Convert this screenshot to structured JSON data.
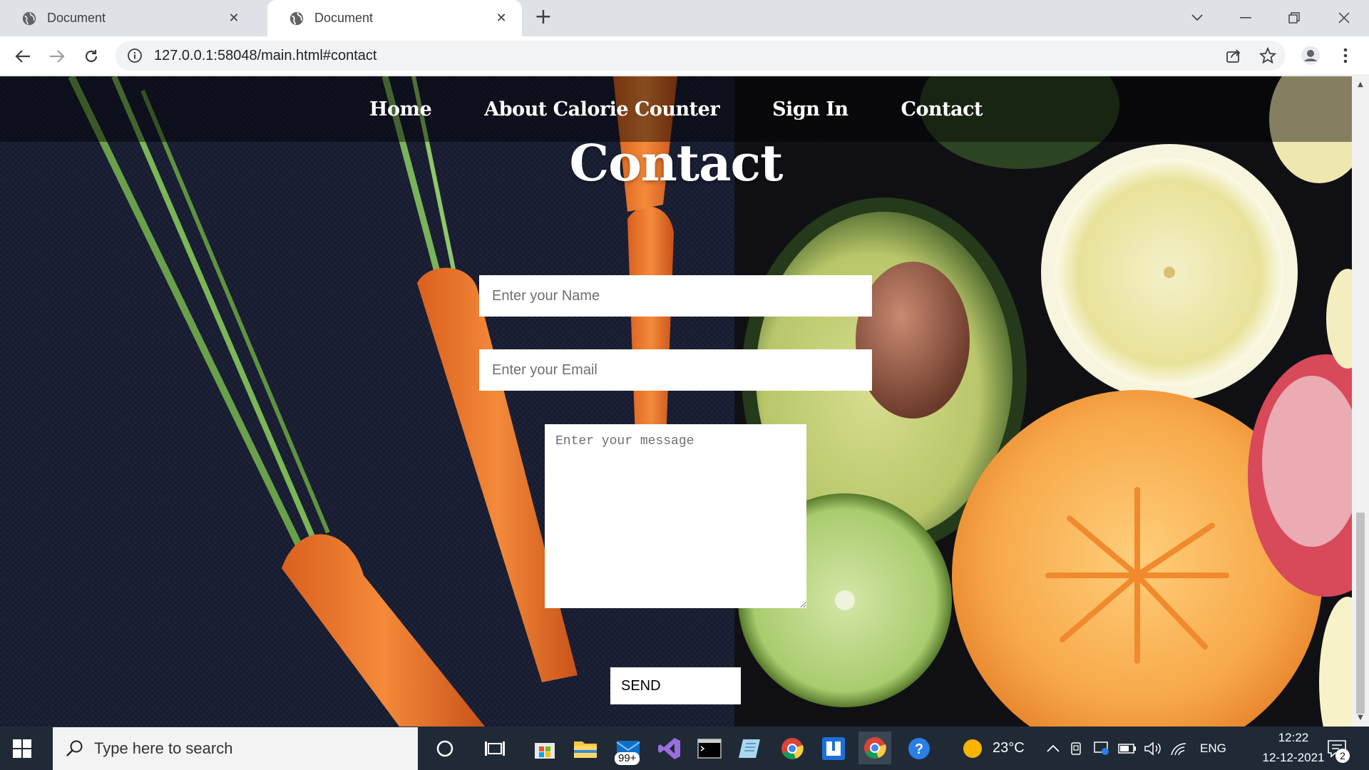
{
  "browser": {
    "tabs": [
      {
        "title": "Document",
        "close": "✕"
      },
      {
        "title": "Document",
        "close": "✕"
      }
    ],
    "new_tab": "+",
    "url": "127.0.0.1:58048/main.html#contact"
  },
  "page": {
    "nav": [
      "Home",
      "About Calorie Counter",
      "Sign In",
      "Contact"
    ],
    "heading": "Contact",
    "form": {
      "name_placeholder": "Enter your Name",
      "email_placeholder": "Enter your Email",
      "message_placeholder": "Enter your message",
      "send_label": "SEND"
    }
  },
  "taskbar": {
    "search_placeholder": "Type here to search",
    "mail_badge": "99+",
    "weather": "23°C",
    "language": "ENG",
    "time": "12:22",
    "date": "12-12-2021",
    "notification_count": "2"
  },
  "colors": {
    "tab_bar": "#dee1e6",
    "taskbar": "#1f2a36",
    "page_bg": "#15182a"
  }
}
